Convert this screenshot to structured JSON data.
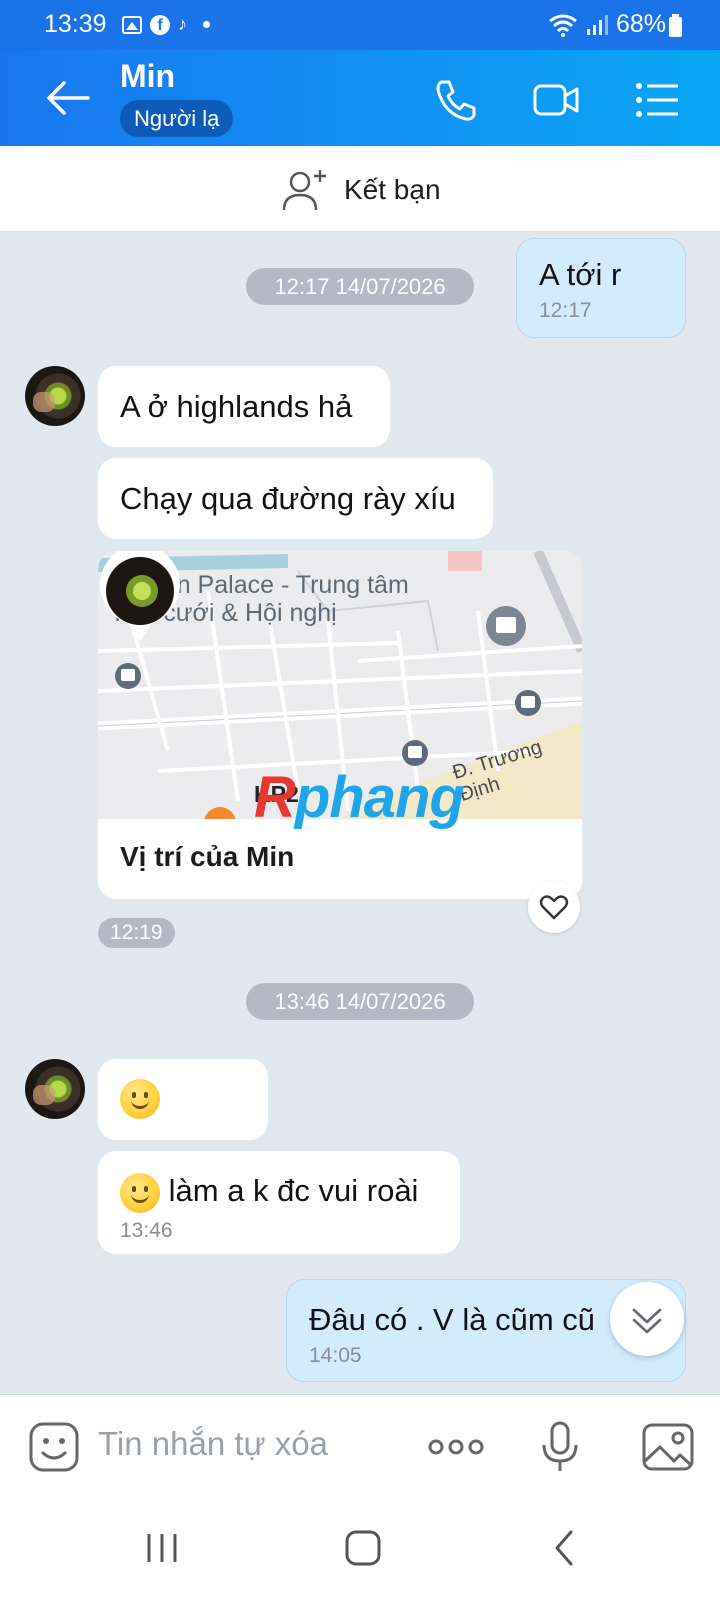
{
  "status_bar": {
    "time": "13:39",
    "battery": "68%",
    "icons": [
      "gallery-icon",
      "facebook-icon",
      "tiktok-icon",
      "dot-icon",
      "wifi-icon",
      "signal-icon",
      "battery-icon"
    ]
  },
  "header": {
    "contact_name": "Min",
    "badge": "Người lạ",
    "back_icon": "arrow-left-icon",
    "actions": [
      "phone-icon",
      "video-icon",
      "menu-list-icon"
    ]
  },
  "add_friend": {
    "label": "Kết bạn",
    "icon": "add-user-icon"
  },
  "chat": {
    "msg1": {
      "text": "A tới r",
      "time": "12:17"
    },
    "date1": "12:17 14/07/2026",
    "msg2": {
      "text": "A ở highlands hả"
    },
    "msg3": {
      "text": "Chạy qua đường rày xíu"
    },
    "location": {
      "place": "Golden Palace - Trung tâm Tiệc cưới & Hội nghị",
      "street": "Đ. Trương Định",
      "area_label": "KP2",
      "label": "Vị trí của Min",
      "time": "12:19"
    },
    "date2": "13:46 14/07/2026",
    "msg4": {
      "emoji": "smiley-emoji"
    },
    "msg5": {
      "text": "làm a k đc vui roài",
      "time": "13:46"
    },
    "msg6": {
      "text": "Đâu có . V là cũm cũ",
      "time": "14:05"
    },
    "watermark": {
      "r": "R",
      "rest": "phang"
    }
  },
  "composer": {
    "placeholder": "Tin nhắn tự xóa",
    "icons": [
      "sticker-icon",
      "more-icon",
      "microphone-icon",
      "image-icon"
    ]
  },
  "colors": {
    "header_start": "#1976f0",
    "header_end": "#0aa7f5",
    "my_bubble": "#d3ebfc",
    "chat_bg": "#e2e8f0"
  }
}
